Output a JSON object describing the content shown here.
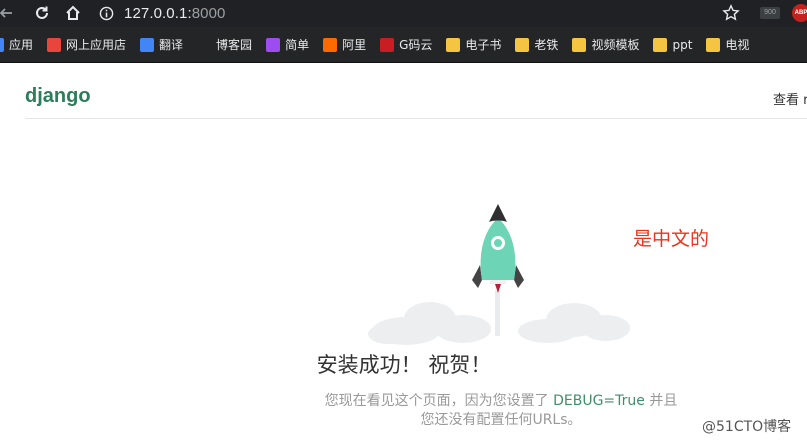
{
  "browser": {
    "url_host": "127.0.0.1:",
    "url_port": "8000",
    "icons": {
      "back": "arrow-left-icon",
      "reload": "reload-icon",
      "home": "home-icon",
      "info": "info-icon",
      "star": "star-icon"
    },
    "extensions": [
      {
        "label": "900",
        "icon": "extension-icon"
      },
      {
        "label": "ABP",
        "icon": "adblock-icon"
      }
    ]
  },
  "bookmarks": [
    {
      "label": "应用",
      "icon": "apps-icon",
      "color": "#4285f4"
    },
    {
      "label": "网上应用店",
      "icon": "web-store-icon",
      "color": "#e8453c"
    },
    {
      "label": "翻译",
      "icon": "translate-icon",
      "color": "#4285f4"
    },
    {
      "label": "博客园",
      "icon": "blog-icon",
      "color": "#242526"
    },
    {
      "label": "简单",
      "icon": "jianshu-icon",
      "color": "#9c4cf0"
    },
    {
      "label": "阿里",
      "icon": "aliyun-icon",
      "color": "#ff6a00"
    },
    {
      "label": "G码云",
      "icon": "gitee-icon",
      "color": "#c71d23"
    },
    {
      "label": "电子书",
      "icon": "folder-icon",
      "color": "#f5c542"
    },
    {
      "label": "老铁",
      "icon": "folder-icon",
      "color": "#f5c542"
    },
    {
      "label": "视频模板",
      "icon": "folder-icon",
      "color": "#f5c542"
    },
    {
      "label": "ppt",
      "icon": "folder-icon",
      "color": "#f5c542"
    },
    {
      "label": "电视",
      "icon": "folder-icon",
      "color": "#f5c542"
    }
  ],
  "page": {
    "logo": "django",
    "header_link": "查看 r",
    "annotation": "是中文的",
    "title": "安装成功！ 祝贺！",
    "desc_before": "您现在看见这个页面，因为您设置了 ",
    "desc_code": "DEBUG=True",
    "desc_after": " 并且",
    "desc_line2": "您还没有配置任何URLs。",
    "watermark": "@51CTO博客",
    "colors": {
      "accent": "#2d7d5a",
      "annotation": "#e8341c",
      "rocket": "#6dd5b5"
    }
  }
}
